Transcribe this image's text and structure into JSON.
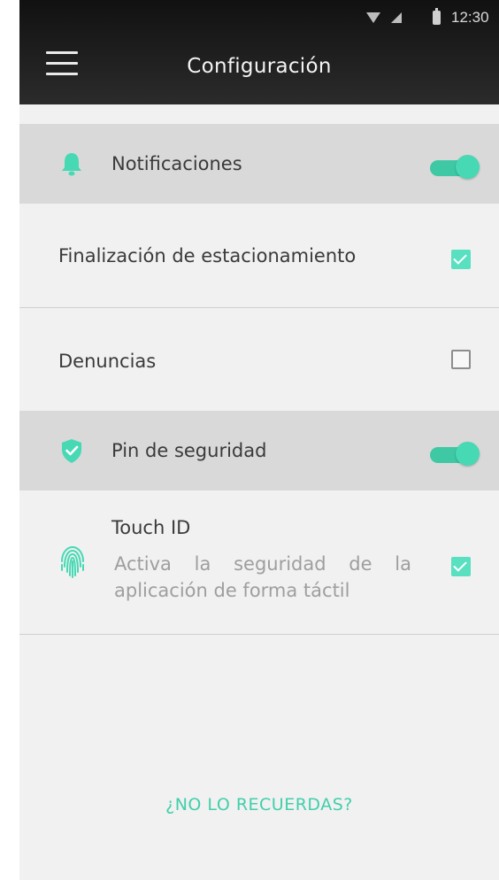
{
  "status_bar": {
    "time": "12:30",
    "icons": [
      "wifi-icon",
      "signal-icon",
      "battery-icon"
    ]
  },
  "app_bar": {
    "menu_icon": "hamburger-menu-icon",
    "title": "Configuración"
  },
  "sections": {
    "notifications": {
      "icon": "bell-icon",
      "label": "Notificaciones",
      "toggle_on": true,
      "items": [
        {
          "label": "Finalización de estacionamiento",
          "checked": true
        },
        {
          "label": "Denuncias",
          "checked": false
        }
      ]
    },
    "security": {
      "icon": "shield-check-icon",
      "label": "Pin de seguridad",
      "toggle_on": true,
      "touch_id": {
        "icon": "fingerprint-icon",
        "title": "Touch ID",
        "description": "Activa la seguridad de la aplicación de forma táctil",
        "checked": true
      }
    }
  },
  "forgot_link": "¿NO LO RECUERDAS?",
  "colors": {
    "accent": "#46d9b4",
    "header_bg": "#d9d9d9",
    "page_bg": "#f1f1f1",
    "top_bar": "#1a1a1a"
  }
}
